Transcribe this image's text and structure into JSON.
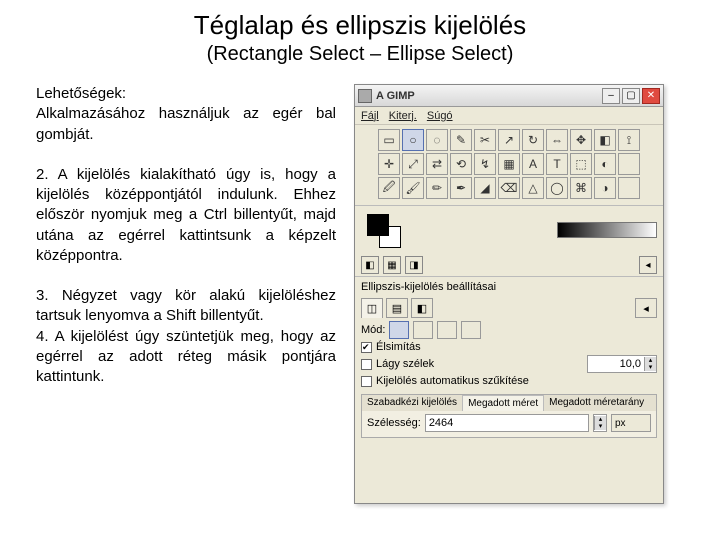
{
  "title": "Téglalap és ellipszis kijelölés",
  "subtitle": "(Rectangle Select – Ellipse Select)",
  "text": {
    "lehet": "Lehetőségek:",
    "p1": "Alkalmazásához használjuk az egér bal gombját.",
    "p2": "2. A kijelölés kialakítható úgy is, hogy a kijelölés középpontjától indulunk. Ehhez először nyomjuk meg a Ctrl billentyűt, majd utána az egérrel kattintsunk a képzelt középpontra.",
    "p3": "3. Négyzet vagy kör alakú kijelöléshez tartsuk lenyomva a Shift billentyűt.",
    "p4": "4. A kijelölést úgy szüntetjük meg, hogy az egérrel az adott réteg másik pontjára kattintunk."
  },
  "gimp": {
    "window_title": "A GIMP",
    "menus": {
      "file": "Fájl",
      "xtns": "Kiterj.",
      "help": "Súgó"
    },
    "tools": [
      "▭",
      "○",
      "◌",
      "✎",
      "✂",
      "↗",
      "↻",
      "⇔",
      "✥",
      "◧",
      "⟟",
      "✛",
      "⤢",
      "⇄",
      "⟲",
      "↯",
      "▦",
      "A",
      "T",
      "⬚",
      "◐",
      "",
      "🖉",
      "🖌",
      "✏",
      "✒",
      "◢",
      "⌫",
      "△",
      "◯",
      "⌘",
      "◑",
      ""
    ],
    "options_title": "Ellipszis-kijelölés beállításai",
    "mode_label": "Mód:",
    "antialias": "Élsimítás",
    "feather": "Lágy szélek",
    "feather_value": "10,0",
    "autoshrink": "Kijelölés automatikus szűkítése",
    "szk_tabs": {
      "a": "Szabadkézi kijelölés",
      "b": "Megadott méret",
      "c": "Megadott méretarány"
    },
    "width_label": "Szélesség:",
    "width_value": "2464",
    "unit": "px"
  }
}
